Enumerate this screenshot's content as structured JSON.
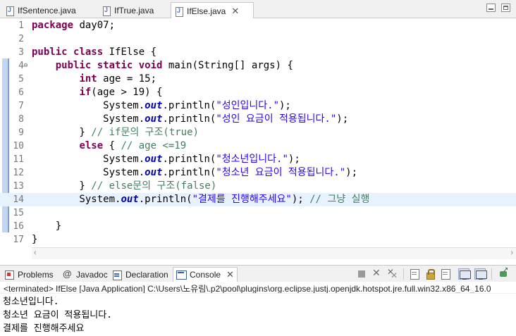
{
  "editor_tabs": [
    {
      "label": "IfSentence.java",
      "active": false
    },
    {
      "label": "IfTrue.java",
      "active": false
    },
    {
      "label": "IfElse.java",
      "active": true
    }
  ],
  "tab_close_symbol": "✕",
  "fold_symbols": {
    "line_4": "⊖"
  },
  "code_lines": [
    {
      "n": "1",
      "t": [
        [
          "kw",
          "package"
        ],
        [
          "",
          " day07;"
        ]
      ]
    },
    {
      "n": "2",
      "t": []
    },
    {
      "n": "3",
      "t": [
        [
          "kw",
          "public"
        ],
        [
          "",
          " "
        ],
        [
          "kw",
          "class"
        ],
        [
          "",
          " IfElse {"
        ]
      ]
    },
    {
      "n": "4",
      "t": [
        [
          "",
          "    "
        ],
        [
          "kw",
          "public"
        ],
        [
          "",
          " "
        ],
        [
          "kw",
          "static"
        ],
        [
          "",
          " "
        ],
        [
          "kw",
          "void"
        ],
        [
          "",
          " main(String[] args) {"
        ]
      ]
    },
    {
      "n": "5",
      "t": [
        [
          "",
          "        "
        ],
        [
          "kw",
          "int"
        ],
        [
          "",
          " age = 15;"
        ]
      ]
    },
    {
      "n": "6",
      "t": [
        [
          "",
          "        "
        ],
        [
          "kw",
          "if"
        ],
        [
          "",
          "(age > 19) {"
        ]
      ]
    },
    {
      "n": "7",
      "t": [
        [
          "",
          "            System."
        ],
        [
          "fld",
          "out"
        ],
        [
          "",
          ".println("
        ],
        [
          "str",
          "\"성인입니다.\""
        ],
        [
          "",
          ");"
        ]
      ]
    },
    {
      "n": "8",
      "t": [
        [
          "",
          "            System."
        ],
        [
          "fld",
          "out"
        ],
        [
          "",
          ".println("
        ],
        [
          "str",
          "\"성인 요금이 적용됩니다.\""
        ],
        [
          "",
          ");"
        ]
      ]
    },
    {
      "n": "9",
      "t": [
        [
          "",
          "        } "
        ],
        [
          "cm",
          "// if문의 구조(true)"
        ]
      ]
    },
    {
      "n": "10",
      "t": [
        [
          "",
          "        "
        ],
        [
          "kw",
          "else"
        ],
        [
          "",
          " { "
        ],
        [
          "cm",
          "// age <=19"
        ]
      ]
    },
    {
      "n": "11",
      "t": [
        [
          "",
          "            System."
        ],
        [
          "fld",
          "out"
        ],
        [
          "",
          ".println("
        ],
        [
          "str",
          "\"청소년입니다.\""
        ],
        [
          "",
          ");"
        ]
      ]
    },
    {
      "n": "12",
      "t": [
        [
          "",
          "            System."
        ],
        [
          "fld",
          "out"
        ],
        [
          "",
          ".println("
        ],
        [
          "str",
          "\"청소년 요금이 적용됩니다.\""
        ],
        [
          "",
          ");"
        ]
      ]
    },
    {
      "n": "13",
      "t": [
        [
          "",
          "        } "
        ],
        [
          "cm",
          "// else문의 구조(false)"
        ]
      ]
    },
    {
      "n": "14",
      "t": [
        [
          "",
          "        System."
        ],
        [
          "fld",
          "out"
        ],
        [
          "",
          ".println("
        ],
        [
          "str",
          "\"결제를 진행해주세요\""
        ],
        [
          "",
          "); "
        ],
        [
          "cm",
          "// 그냥 실행"
        ]
      ],
      "current": true
    },
    {
      "n": "15",
      "t": []
    },
    {
      "n": "16",
      "t": [
        [
          "",
          "    }"
        ]
      ]
    },
    {
      "n": "17",
      "t": [
        [
          "",
          "}"
        ]
      ]
    }
  ],
  "views": {
    "tabs": [
      {
        "name": "problems",
        "label": "Problems",
        "active": false
      },
      {
        "name": "javadoc",
        "label": "Javadoc",
        "active": false
      },
      {
        "name": "declaration",
        "label": "Declaration",
        "active": false
      },
      {
        "name": "console",
        "label": "Console",
        "active": true
      }
    ],
    "toolbar_icons": [
      "stop-icon",
      "remove-launch-icon",
      "remove-all-terminated-icon",
      "clear-console-icon",
      "scroll-lock-icon",
      "word-wrap-icon",
      "show-when-stdout-changes-icon",
      "show-when-stderr-changes-icon",
      "pin-console-icon"
    ]
  },
  "console": {
    "header": "<terminated> IfElse [Java Application] C:\\Users\\노유림\\.p2\\pool\\plugins\\org.eclipse.justj.openjdk.hotspot.jre.full.win32.x86_64_16.0",
    "output": [
      "청소년입니다.",
      "청소년 요금이 적용됩니다.",
      "결제를 진행해주세요"
    ]
  },
  "colors": {
    "keyword": "#7f0055",
    "string": "#2a00ff",
    "comment": "#3f7f5f",
    "static_field": "#0000c0",
    "current_line": "#e8f2fe"
  }
}
